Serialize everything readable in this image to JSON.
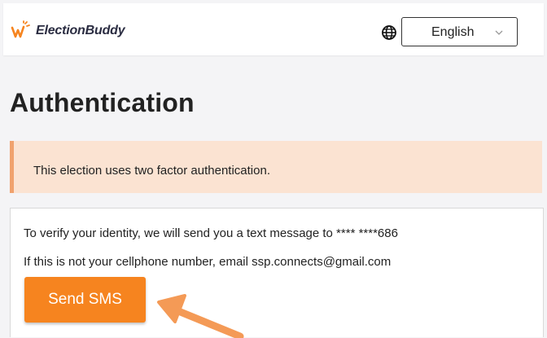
{
  "header": {
    "logo_text": "ElectionBuddy",
    "language": {
      "selected": "English",
      "options": [
        "English"
      ]
    }
  },
  "page": {
    "title": "Authentication",
    "alert": "This election uses two factor authentication.",
    "verify_text": "To verify your identity, we will send you a text message to **** ****686",
    "not_yours_text": "If this is not your cellphone number, email ssp.connects@gmail.com",
    "send_button_label": "Send SMS"
  },
  "colors": {
    "brand_orange": "#f6841f",
    "alert_background": "#fbe3d2",
    "alert_border": "#f0a26e",
    "annotation_arrow": "#f49a56"
  },
  "icons": [
    "electionbuddy-logo-icon",
    "globe-icon",
    "chevron-down-icon",
    "annotation-arrow"
  ]
}
